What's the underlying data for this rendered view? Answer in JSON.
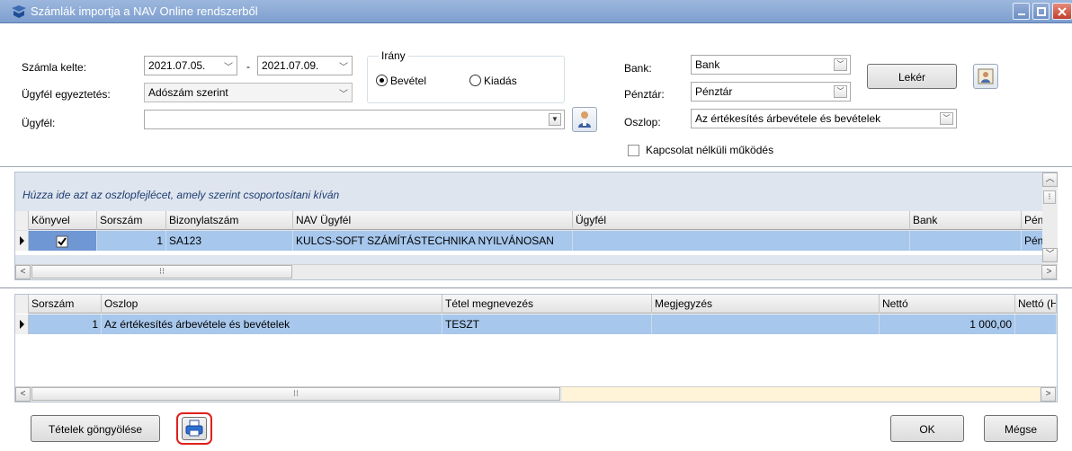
{
  "window": {
    "title": "Számlák importja a NAV Online rendszerből"
  },
  "form": {
    "szamla_kelte_label": "Számla kelte:",
    "date_from": "2021.07.05.",
    "date_sep": "-",
    "date_to": "2021.07.09.",
    "ugyfel_egyeztetes_label": "Ügyfél egyeztetés:",
    "ugyfel_egyeztetes_value": "Adószám szerint",
    "ugyfel_label": "Ügyfél:",
    "ugyfel_value": "",
    "irany": {
      "title": "Irány",
      "options": [
        "Bevétel",
        "Kiadás"
      ],
      "selected": "Bevétel"
    },
    "bank_label": "Bank:",
    "bank_value": "Bank",
    "penztar_label": "Pénztár:",
    "penztar_value": "Pénztár",
    "oszlop_label": "Oszlop:",
    "oszlop_value": "Az értékesítés árbevétele és bevételek",
    "offline_label": "Kapcsolat nélküli működés",
    "offline_checked": false,
    "leker_button": "Lekér"
  },
  "grid1": {
    "group_hint": "Húzza ide azt az oszlopfejlécet, amely szerint csoportosítani kíván",
    "columns": [
      "Könyvel",
      "Sorszám",
      "Bizonylatszám",
      "NAV Ügyfél",
      "Ügyfél",
      "Bank",
      "Pénzt"
    ],
    "rows": [
      {
        "konyvel": true,
        "sorszam": "1",
        "bizonylatszam": "SA123",
        "nav_ugyfel": "KULCS-SOFT SZÁMÍTÁSTECHNIKA NYILVÁNOSAN",
        "ugyfel": "",
        "bank": "",
        "penztar": "Pénzt"
      }
    ]
  },
  "grid2": {
    "columns": [
      "Sorszám",
      "Oszlop",
      "Tétel megnevezés",
      "Megjegyzés",
      "Nettó",
      "Nettó (HU"
    ],
    "rows": [
      {
        "sorszam": "1",
        "oszlop": "Az értékesítés árbevétele és bevételek",
        "tetel": "TESZT",
        "megjegyzes": "",
        "netto": "1 000,00",
        "netto_huf": ""
      }
    ]
  },
  "footer": {
    "tetelek_button": "Tételek göngyölése",
    "ok_button": "OK",
    "megse_button": "Mégse"
  },
  "colors": {
    "titlebar": "#8aa8d6",
    "row_selected": "#a7c7ec",
    "group_bar": "#dfe5ee",
    "highlight_border": "#e0201c"
  }
}
